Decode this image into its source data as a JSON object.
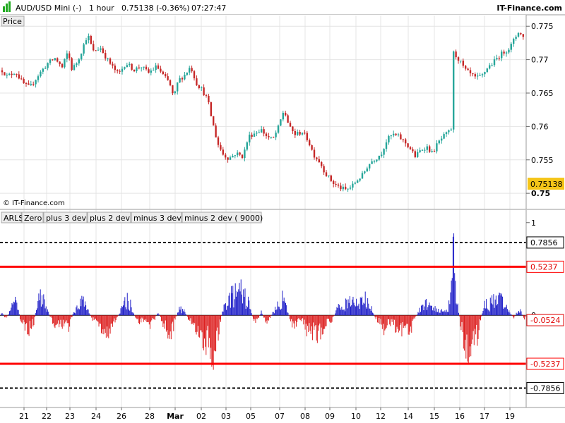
{
  "header": {
    "instrument": "AUD/USD Mini (-)",
    "timeframe": "1 hour",
    "last_quote": "0.75138 (-0.36%)",
    "time": "07:27:47",
    "brand": "IT-Finance.com"
  },
  "colors": {
    "up": "#26a69a",
    "down": "#c62828",
    "hist_pos": "#1f1fc8",
    "hist_neg": "#dd2020",
    "band2": "#ff0000",
    "band3": "#000000",
    "price_badge": "#f5c518"
  },
  "chart_data": [
    {
      "type": "candlestick",
      "panel_label": "Price",
      "watermark": "© IT-Finance.com",
      "ylim": [
        0.7478,
        0.7765
      ],
      "y_ticks": [
        0.775,
        0.77,
        0.765,
        0.76,
        0.755,
        0.75
      ],
      "y_tick_labels": [
        "0.775",
        "0.77",
        "0.765",
        "0.76",
        "0.755",
        "0.75"
      ],
      "last_price": 0.75138,
      "last_price_label": "0.75138",
      "path": [
        [
          0,
          0.7688
        ],
        [
          10,
          0.7675
        ],
        [
          22,
          0.7682
        ],
        [
          32,
          0.7665
        ],
        [
          42,
          0.7658
        ],
        [
          55,
          0.7678
        ],
        [
          68,
          0.7695
        ],
        [
          78,
          0.7702
        ],
        [
          88,
          0.7688
        ],
        [
          96,
          0.7712
        ],
        [
          102,
          0.7685
        ],
        [
          110,
          0.7698
        ],
        [
          118,
          0.772
        ],
        [
          124,
          0.7738
        ],
        [
          132,
          0.7712
        ],
        [
          142,
          0.7718
        ],
        [
          152,
          0.77
        ],
        [
          160,
          0.7688
        ],
        [
          168,
          0.7678
        ],
        [
          178,
          0.7695
        ],
        [
          190,
          0.7685
        ],
        [
          200,
          0.769
        ],
        [
          210,
          0.768
        ],
        [
          222,
          0.769
        ],
        [
          232,
          0.7675
        ],
        [
          240,
          0.7665
        ],
        [
          246,
          0.7642
        ],
        [
          252,
          0.7668
        ],
        [
          262,
          0.7678
        ],
        [
          270,
          0.769
        ],
        [
          278,
          0.7665
        ],
        [
          286,
          0.7655
        ],
        [
          294,
          0.764
        ],
        [
          300,
          0.761
        ],
        [
          308,
          0.7575
        ],
        [
          316,
          0.7558
        ],
        [
          324,
          0.7552
        ],
        [
          334,
          0.756
        ],
        [
          344,
          0.7555
        ],
        [
          352,
          0.7585
        ],
        [
          360,
          0.759
        ],
        [
          370,
          0.7595
        ],
        [
          378,
          0.7585
        ],
        [
          386,
          0.758
        ],
        [
          394,
          0.7598
        ],
        [
          402,
          0.7625
        ],
        [
          410,
          0.7598
        ],
        [
          418,
          0.7588
        ],
        [
          428,
          0.7592
        ],
        [
          436,
          0.758
        ],
        [
          444,
          0.7558
        ],
        [
          452,
          0.7548
        ],
        [
          462,
          0.7528
        ],
        [
          472,
          0.7515
        ],
        [
          482,
          0.7508
        ],
        [
          490,
          0.7505
        ],
        [
          498,
          0.751
        ],
        [
          506,
          0.752
        ],
        [
          514,
          0.7528
        ],
        [
          520,
          0.754
        ],
        [
          526,
          0.7548
        ],
        [
          532,
          0.7552
        ],
        [
          540,
          0.756
        ],
        [
          548,
          0.758
        ],
        [
          556,
          0.7588
        ],
        [
          564,
          0.7585
        ],
        [
          572,
          0.7578
        ],
        [
          580,
          0.7568
        ],
        [
          588,
          0.7555
        ],
        [
          596,
          0.7565
        ],
        [
          604,
          0.757
        ],
        [
          612,
          0.756
        ],
        [
          620,
          0.7575
        ],
        [
          628,
          0.7585
        ],
        [
          636,
          0.7592
        ],
        [
          640,
          0.7598
        ],
        [
          642,
          0.771
        ],
        [
          650,
          0.77
        ],
        [
          658,
          0.7685
        ],
        [
          666,
          0.7678
        ],
        [
          674,
          0.7672
        ],
        [
          682,
          0.7675
        ],
        [
          690,
          0.7688
        ],
        [
          698,
          0.7695
        ],
        [
          706,
          0.7705
        ],
        [
          714,
          0.7712
        ],
        [
          722,
          0.7718
        ],
        [
          728,
          0.773
        ],
        [
          734,
          0.7742
        ],
        [
          740,
          0.7735
        ],
        [
          744,
          0.7728
        ]
      ]
    },
    {
      "type": "bar",
      "legend": [
        "ARLS",
        "Zero",
        "plus 3 dev",
        "plus 2 dev",
        "minus 3 dev",
        "minus 2 dev ( 9000)"
      ],
      "legend_colors": [
        "#ff0000",
        "#000000",
        "#000000",
        "#ff0000",
        "#000000",
        "#ff0000"
      ],
      "ylim": [
        -0.98,
        1.12
      ],
      "y_ticks": [
        1,
        0
      ],
      "y_tick_labels": [
        "1",
        "0"
      ],
      "bands": [
        {
          "name": "plus 3 dev",
          "value": 0.7856,
          "label": "0.7856",
          "style": "dashed",
          "color": "#000000"
        },
        {
          "name": "plus 2 dev",
          "value": 0.5237,
          "label": "0.5237",
          "style": "solid",
          "color": "#ff0000"
        },
        {
          "name": "minus 2 dev ( 9000)",
          "value": -0.5237,
          "label": "-0.5237",
          "style": "solid",
          "color": "#ff0000"
        },
        {
          "name": "minus 3 dev",
          "value": -0.7856,
          "label": "-0.7856",
          "style": "dashed",
          "color": "#000000"
        }
      ],
      "last_value": -0.0524,
      "last_value_label": "-0.0524",
      "profile": [
        [
          0,
          0.12
        ],
        [
          8,
          -0.05
        ],
        [
          14,
          0.05
        ],
        [
          20,
          0.22
        ],
        [
          26,
          0.08
        ],
        [
          30,
          -0.12
        ],
        [
          36,
          -0.18
        ],
        [
          42,
          -0.22
        ],
        [
          48,
          -0.1
        ],
        [
          54,
          0.25
        ],
        [
          60,
          0.3
        ],
        [
          66,
          0.15
        ],
        [
          72,
          -0.05
        ],
        [
          78,
          -0.15
        ],
        [
          84,
          -0.2
        ],
        [
          92,
          -0.1
        ],
        [
          98,
          -0.18
        ],
        [
          104,
          0.05
        ],
        [
          112,
          0.15
        ],
        [
          118,
          0.28
        ],
        [
          124,
          0.1
        ],
        [
          130,
          -0.05
        ],
        [
          138,
          -0.12
        ],
        [
          146,
          -0.22
        ],
        [
          152,
          -0.3
        ],
        [
          158,
          -0.18
        ],
        [
          164,
          -0.1
        ],
        [
          170,
          0.05
        ],
        [
          176,
          0.18
        ],
        [
          182,
          0.25
        ],
        [
          188,
          0.05
        ],
        [
          194,
          -0.08
        ],
        [
          200,
          -0.1
        ],
        [
          206,
          -0.05
        ],
        [
          212,
          -0.15
        ],
        [
          218,
          -0.08
        ],
        [
          224,
          0.05
        ],
        [
          230,
          -0.12
        ],
        [
          236,
          -0.25
        ],
        [
          242,
          -0.32
        ],
        [
          248,
          -0.08
        ],
        [
          254,
          0.1
        ],
        [
          260,
          0.08
        ],
        [
          266,
          -0.05
        ],
        [
          272,
          -0.1
        ],
        [
          278,
          -0.2
        ],
        [
          284,
          -0.3
        ],
        [
          290,
          -0.4
        ],
        [
          296,
          -0.48
        ],
        [
          300,
          -0.55
        ],
        [
          304,
          -0.6
        ],
        [
          310,
          -0.2
        ],
        [
          316,
          0.1
        ],
        [
          322,
          0.22
        ],
        [
          328,
          0.3
        ],
        [
          334,
          0.32
        ],
        [
          340,
          0.38
        ],
        [
          346,
          0.28
        ],
        [
          352,
          0.2
        ],
        [
          358,
          -0.05
        ],
        [
          364,
          -0.1
        ],
        [
          370,
          0.05
        ],
        [
          376,
          -0.1
        ],
        [
          382,
          -0.05
        ],
        [
          388,
          0.08
        ],
        [
          394,
          0.15
        ],
        [
          400,
          0.25
        ],
        [
          406,
          0.1
        ],
        [
          412,
          -0.1
        ],
        [
          418,
          -0.2
        ],
        [
          424,
          -0.05
        ],
        [
          430,
          -0.1
        ],
        [
          436,
          -0.25
        ],
        [
          442,
          -0.3
        ],
        [
          448,
          -0.32
        ],
        [
          454,
          -0.25
        ],
        [
          460,
          -0.15
        ],
        [
          466,
          -0.1
        ],
        [
          472,
          -0.05
        ],
        [
          478,
          0.12
        ],
        [
          484,
          0.1
        ],
        [
          490,
          0.18
        ],
        [
          496,
          0.2
        ],
        [
          502,
          0.22
        ],
        [
          508,
          0.15
        ],
        [
          514,
          0.28
        ],
        [
          520,
          0.2
        ],
        [
          526,
          0.1
        ],
        [
          532,
          -0.05
        ],
        [
          538,
          -0.1
        ],
        [
          544,
          -0.2
        ],
        [
          550,
          -0.12
        ],
        [
          556,
          -0.15
        ],
        [
          562,
          -0.22
        ],
        [
          568,
          -0.28
        ],
        [
          574,
          -0.3
        ],
        [
          580,
          -0.25
        ],
        [
          586,
          -0.1
        ],
        [
          592,
          0.05
        ],
        [
          598,
          0.12
        ],
        [
          604,
          0.2
        ],
        [
          610,
          0.15
        ],
        [
          616,
          0.12
        ],
        [
          622,
          0.05
        ],
        [
          628,
          0.08
        ],
        [
          634,
          0.1
        ],
        [
          638,
          0.3
        ],
        [
          640,
          0.7
        ],
        [
          642,
          1.08
        ],
        [
          644,
          0.55
        ],
        [
          646,
          0.45
        ],
        [
          648,
          0.2
        ],
        [
          652,
          -0.15
        ],
        [
          656,
          -0.35
        ],
        [
          660,
          -0.45
        ],
        [
          664,
          -0.5
        ],
        [
          668,
          -0.48
        ],
        [
          672,
          -0.4
        ],
        [
          676,
          -0.3
        ],
        [
          680,
          -0.15
        ],
        [
          684,
          0.1
        ],
        [
          688,
          0.18
        ],
        [
          692,
          0.15
        ],
        [
          698,
          0.22
        ],
        [
          704,
          0.2
        ],
        [
          710,
          0.25
        ],
        [
          716,
          0.12
        ],
        [
          722,
          0.05
        ],
        [
          728,
          -0.05
        ],
        [
          734,
          0.1
        ],
        [
          738,
          0.05
        ],
        [
          742,
          -0.05
        ]
      ]
    }
  ],
  "x_axis": {
    "tick_labels": [
      "21",
      "22",
      "23",
      "24",
      "26",
      "28",
      "Mar",
      "02",
      "03",
      "05",
      "07",
      "08",
      "09",
      "10",
      "12",
      "14",
      "15",
      "16",
      "17",
      "19"
    ],
    "bold_labels": [
      "Mar"
    ]
  }
}
